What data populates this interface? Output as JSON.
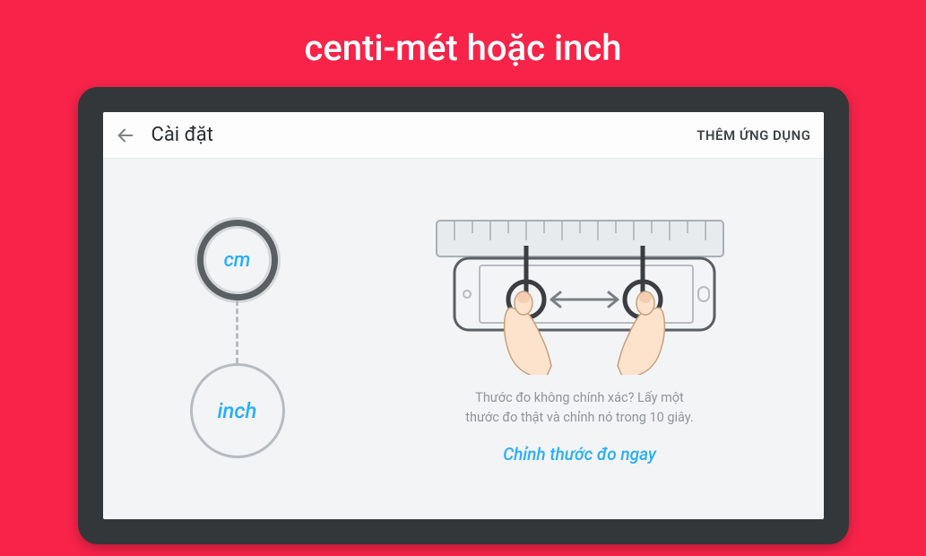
{
  "banner": {
    "title": "centi-mét hoặc inch"
  },
  "topbar": {
    "title": "Cài đặt",
    "action": "THÊM ỨNG DỤNG"
  },
  "units": {
    "cm": "cm",
    "inch": "inch"
  },
  "help": {
    "line1": "Thước đo không chính xác? Lấy một",
    "line2": "thước đo thật và chỉnh nó trong 10 giây."
  },
  "calibrate": "Chỉnh thước đo ngay"
}
